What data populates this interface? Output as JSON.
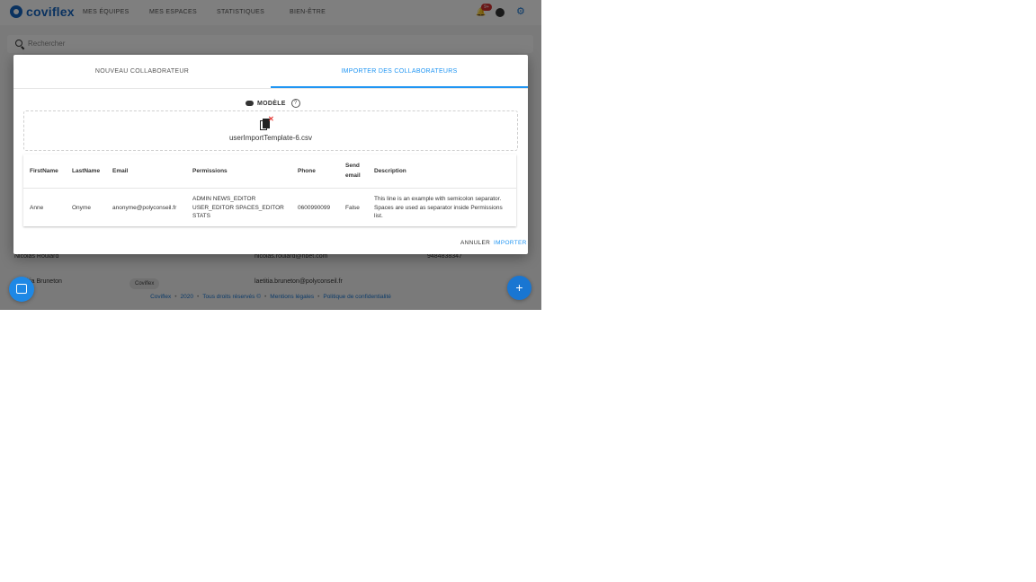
{
  "app": {
    "logo_text": "coviflex",
    "nav": [
      "MES ÉQUIPES",
      "MES ESPACES",
      "STATISTIQUES",
      "BIEN-ÊTRE"
    ],
    "notification_badge": "9+",
    "search_placeholder": "Rechercher",
    "rows": [
      {
        "name": "Nicolas Roulard",
        "email": "nicolas.roulard@hbet.com",
        "phone": "9484838347"
      },
      {
        "name": "Laetitia Bruneton",
        "chip": "Coviflex",
        "email": "laetitia.bruneton@polyconseil.fr"
      }
    ],
    "footer": [
      "Coviflex",
      "2020",
      "Tous droits réservés ©",
      "Mentions légales",
      "Politique de confidentialité"
    ],
    "fab_label": "+"
  },
  "dialog": {
    "tabs": [
      "NOUVEAU COLLABORATEUR",
      "IMPORTER DES COLLABORATEURS"
    ],
    "active_tab": 1,
    "model_label": "MODÈLE",
    "help_glyph": "?",
    "file_name": "userImportTemplate-6.csv",
    "table": {
      "headers": [
        "FirstName",
        "LastName",
        "Email",
        "Permissions",
        "Phone",
        "Send email",
        "Description"
      ],
      "rows": [
        [
          "Anne",
          "Onyme",
          "anonyme@polyconseil.fr",
          "ADMIN NEWS_EDITOR USER_EDITOR SPACES_EDITOR STATS",
          "0600990099",
          "False",
          "This line is an example with semicolon separator. Spaces are used as separator inside Permissions list."
        ]
      ]
    },
    "buttons": {
      "cancel": "ANNULER",
      "import": "IMPORTER"
    }
  },
  "colors": {
    "primary": "#2196f3",
    "brand": "#1565c0",
    "badge": "#d32f2f",
    "remove": "#e53935"
  }
}
